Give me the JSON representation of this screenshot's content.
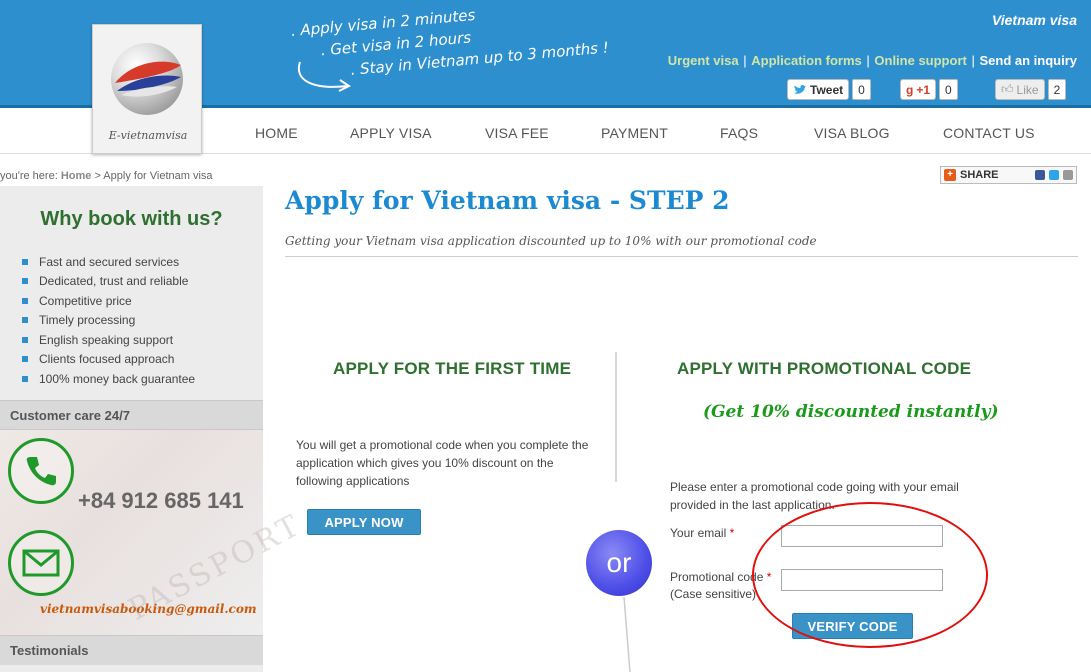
{
  "header": {
    "brand": "Vietnam visa",
    "logo_text": "E-vietnamvisa",
    "slogan": [
      ". Apply visa in 2 minutes",
      ". Get visa in 2 hours",
      ". Stay in Vietnam up to 3 months !"
    ],
    "links": {
      "urgent": "Urgent visa",
      "forms": "Application forms",
      "support": "Online support",
      "inquiry": "Send an inquiry",
      "sep": "|"
    },
    "social": {
      "tweet_label": "Tweet",
      "tweet_count": "0",
      "gplus_label": "+1",
      "gplus_count": "0",
      "like_label": "Like",
      "like_count": "2"
    }
  },
  "nav": [
    "HOME",
    "APPLY VISA",
    "VISA FEE",
    "PAYMENT",
    "FAQS",
    "VISA BLOG",
    "CONTACT US"
  ],
  "breadcrumb": {
    "prefix": "you're here:",
    "home": "Home",
    "current": "> Apply for Vietnam visa"
  },
  "share_label": "SHARE",
  "sidebar": {
    "why_title": "Why book with us?",
    "why_items": [
      "Fast and secured services",
      "Dedicated, trust and reliable",
      "Competitive price",
      "Timely processing",
      "English speaking support",
      "Clients focused approach",
      "100% money back guarantee"
    ],
    "care_title": "Customer care 24/7",
    "phone": "+84 912 685 141",
    "email": "vietnamvisabooking@gmail.com",
    "passport_watermark": "PASSPORT",
    "testimonials_title": "Testimonials"
  },
  "main": {
    "title": "Apply for Vietnam visa - STEP 2",
    "subtitle": "Getting your Vietnam visa application discounted up to 10% with our promotional code",
    "left": {
      "heading": "APPLY FOR THE FIRST TIME",
      "text": "You will get a promotional code when you complete the application which gives you 10% discount on the following applications",
      "button": "APPLY NOW"
    },
    "or_label": "or",
    "right": {
      "heading": "APPLY WITH PROMOTIONAL CODE",
      "subheading": "(Get 10% discounted instantly)",
      "text": "Please enter a promotional code going with your email provided in the last application.",
      "email_label": "Your email",
      "code_label": "Promotional code",
      "code_hint": "(Case sensitive)",
      "required_mark": "*",
      "email_value": "",
      "code_value": "",
      "button": "VERIFY CODE"
    }
  },
  "colors": {
    "header_blue": "#2e8fce",
    "green_heading": "#2f6f2f",
    "title_blue": "#1b8ad1",
    "button_blue": "#3a93c7",
    "annotation_red": "#e01010"
  }
}
